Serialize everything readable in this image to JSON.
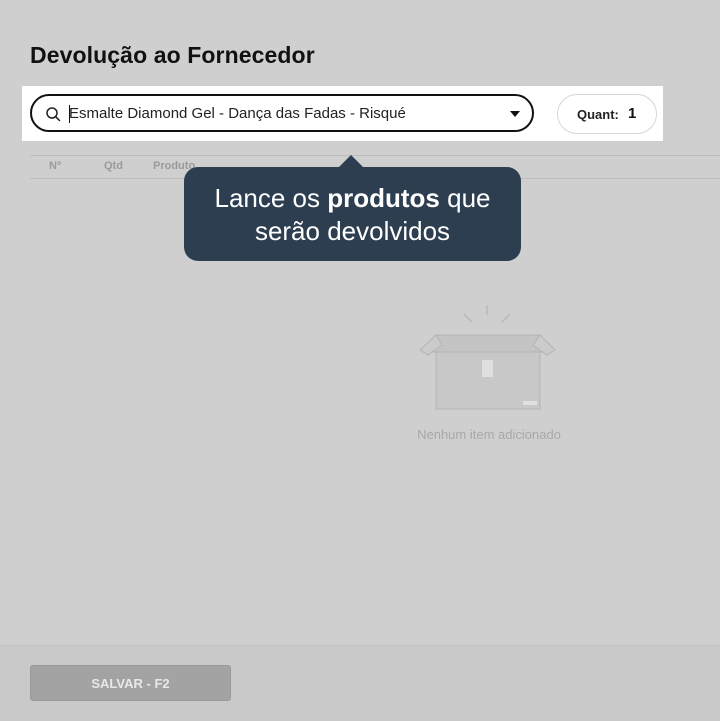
{
  "page": {
    "title": "Devolução ao Fornecedor"
  },
  "search": {
    "value": "Esmalte Diamond Gel - Dança das Fadas - Risqué",
    "icon": "search-icon",
    "dropdown_icon": "chevron-down-icon"
  },
  "quantity": {
    "label": "Quant:",
    "value": "1"
  },
  "table": {
    "columns": [
      "Nº",
      "Qtd",
      "Produto"
    ]
  },
  "tooltip": {
    "text_before": "Lance os ",
    "text_bold": "produtos",
    "text_after": " que serão devolvidos",
    "background": "#2c3e50"
  },
  "empty_state": {
    "message": "Nenhum item adicionado",
    "icon": "empty-box-icon"
  },
  "footer": {
    "save_label": "SALVAR - F2"
  }
}
